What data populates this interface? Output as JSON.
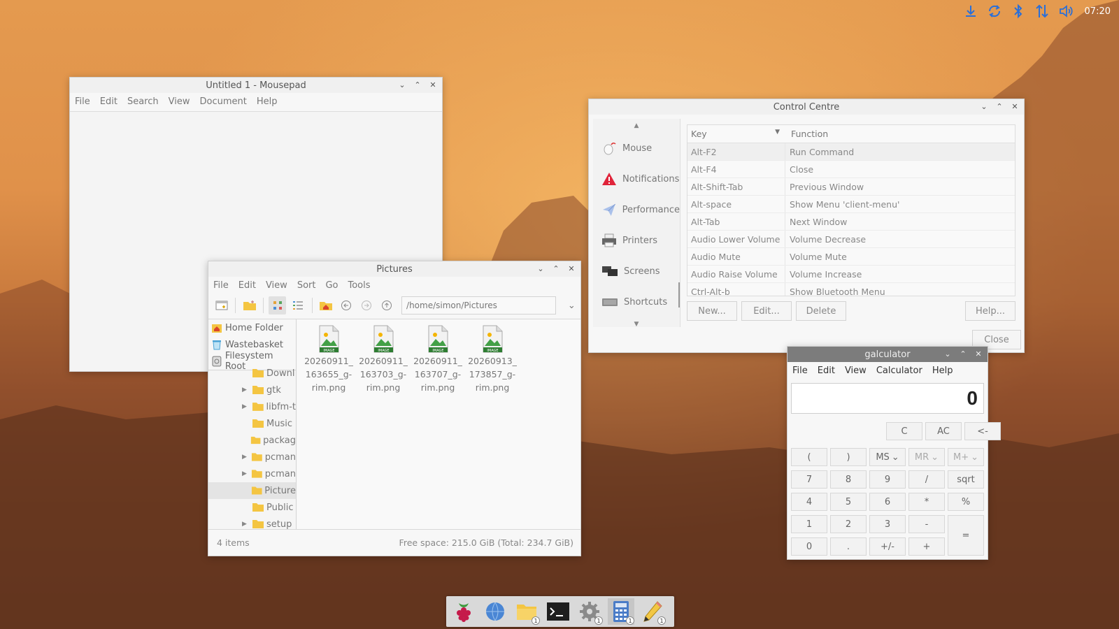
{
  "tray": {
    "clock": "07:20",
    "icons": [
      "download-icon",
      "sync-icon",
      "bluetooth-icon",
      "network-icon",
      "volume-icon"
    ]
  },
  "mousepad": {
    "title": "Untitled 1 - Mousepad",
    "menu": [
      "File",
      "Edit",
      "Search",
      "View",
      "Document",
      "Help"
    ]
  },
  "pictures": {
    "title": "Pictures",
    "menu": [
      "File",
      "Edit",
      "View",
      "Sort",
      "Go",
      "Tools"
    ],
    "path": "/home/simon/Pictures",
    "places": [
      "Home Folder",
      "Wastebasket",
      "Filesystem Root"
    ],
    "tree": [
      {
        "label": "Downl",
        "arrow": false
      },
      {
        "label": "gtk",
        "arrow": true
      },
      {
        "label": "libfm-t",
        "arrow": true
      },
      {
        "label": "Music",
        "arrow": false
      },
      {
        "label": "packag",
        "arrow": false
      },
      {
        "label": "pcman",
        "arrow": true
      },
      {
        "label": "pcman",
        "arrow": true
      },
      {
        "label": "Picture",
        "arrow": false
      },
      {
        "label": "Public",
        "arrow": false
      },
      {
        "label": "setup",
        "arrow": true
      }
    ],
    "files": [
      "20260911_163655_g-rim.png",
      "20260911_163703_g-rim.png",
      "20260911_163707_g-rim.png",
      "20260913_173857_g-rim.png"
    ],
    "file_lines": [
      [
        "20260911_",
        "163655_g-",
        "rim.png"
      ],
      [
        "20260911_",
        "163703_g-",
        "rim.png"
      ],
      [
        "20260911_",
        "163707_g-",
        "rim.png"
      ],
      [
        "20260913_",
        "173857_g-",
        "rim.png"
      ]
    ],
    "image_badge": "IMAGE",
    "status_left": "4 items",
    "status_right": "Free space: 215.0 GiB (Total: 234.7 GiB)"
  },
  "control": {
    "title": "Control Centre",
    "sidebar": [
      "Mouse",
      "Notifications",
      "Performance",
      "Printers",
      "Screens",
      "Shortcuts"
    ],
    "table_headers": {
      "key": "Key",
      "function": "Function"
    },
    "rows": [
      {
        "key": "Alt-F2",
        "function": "Run Command"
      },
      {
        "key": "Alt-F4",
        "function": "Close"
      },
      {
        "key": "Alt-Shift-Tab",
        "function": "Previous Window"
      },
      {
        "key": "Alt-space",
        "function": "Show Menu 'client-menu'"
      },
      {
        "key": "Alt-Tab",
        "function": "Next Window"
      },
      {
        "key": "Audio Lower Volume",
        "function": "Volume Decrease"
      },
      {
        "key": "Audio Mute",
        "function": "Volume Mute"
      },
      {
        "key": "Audio Raise Volume",
        "function": "Volume Increase"
      },
      {
        "key": "Ctrl-Alt-b",
        "function": "Show Bluetooth Menu"
      }
    ],
    "buttons": {
      "new": "New...",
      "edit": "Edit...",
      "delete": "Delete",
      "help": "Help...",
      "close": "Close"
    }
  },
  "calc": {
    "title": "galculator",
    "menu": [
      "File",
      "Edit",
      "View",
      "Calculator",
      "Help"
    ],
    "display": "0",
    "top_keys": [
      "C",
      "AC",
      "<-"
    ],
    "mem_keys": [
      "(",
      ")",
      "MS",
      "MR",
      "M+"
    ],
    "rows": [
      [
        "7",
        "8",
        "9",
        "/",
        "sqrt"
      ],
      [
        "4",
        "5",
        "6",
        "*",
        "%"
      ],
      [
        "1",
        "2",
        "3",
        "-"
      ],
      [
        "0",
        ".",
        "+/-",
        "+"
      ]
    ],
    "equals": "="
  },
  "dock": {
    "items": [
      {
        "name": "raspberry-menu-icon",
        "badge": ""
      },
      {
        "name": "browser-icon",
        "badge": ""
      },
      {
        "name": "file-manager-icon",
        "badge": "1"
      },
      {
        "name": "terminal-icon",
        "badge": ""
      },
      {
        "name": "settings-icon",
        "badge": "1"
      },
      {
        "name": "calculator-icon",
        "badge": "1"
      },
      {
        "name": "text-editor-icon",
        "badge": "1"
      }
    ]
  }
}
